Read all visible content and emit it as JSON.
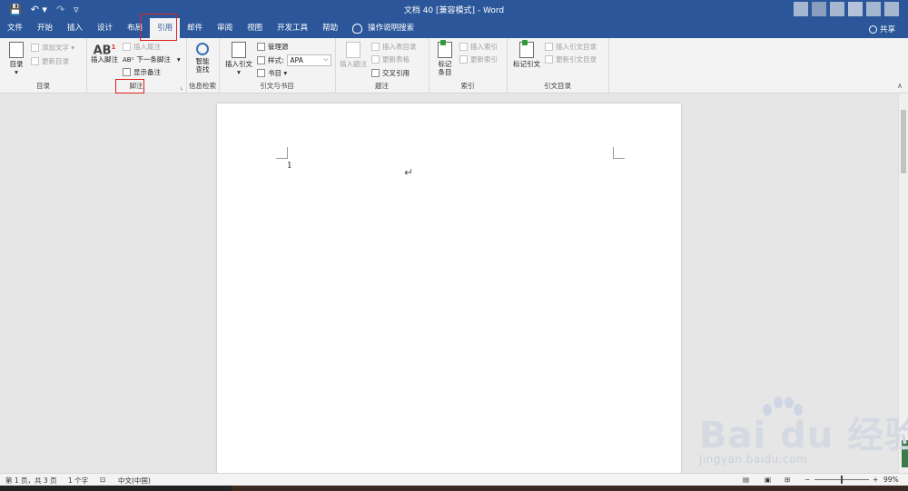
{
  "title_bar": {
    "doc_title": "文档 40 [兼容模式]  -  Word",
    "qat_icons": [
      "save-icon",
      "undo-icon",
      "redo-icon",
      "customize-icon"
    ]
  },
  "tabs": [
    "文件",
    "开始",
    "插入",
    "设计",
    "布局",
    "引用",
    "邮件",
    "审阅",
    "视图",
    "开发工具",
    "帮助"
  ],
  "active_tab": "引用",
  "tell_me": "操作说明搜索",
  "share": "共享",
  "ribbon": {
    "toc": {
      "label": "目录",
      "big": "目录",
      "add_text": "添加文字 ▾",
      "update": "更新目录"
    },
    "footnotes": {
      "label": "脚注",
      "insert_footnote": "插入脚注",
      "insert_endnote": "插入尾注",
      "next_footnote": "下一条脚注",
      "next_arrow": "▾",
      "show_notes": "显示备注"
    },
    "research": {
      "label": "信息检索",
      "smart_lookup_1": "智能",
      "smart_lookup_2": "查找"
    },
    "citations": {
      "label": "引文与书目",
      "insert_citation": "插入引文",
      "manage_sources": "管理源",
      "style": "样式:",
      "style_value": "APA",
      "bibliography": "书目 ▾"
    },
    "captions": {
      "label": "题注",
      "insert_caption": "插入题注",
      "insert_tof": "插入表目录",
      "update_table": "更新表格",
      "cross_ref": "交叉引用"
    },
    "index": {
      "label": "索引",
      "mark_entry_1": "标记",
      "mark_entry_2": "条目",
      "insert_index": "插入索引",
      "update_index": "更新索引"
    },
    "toa": {
      "label": "引文目录",
      "mark_citation": "标记引文",
      "insert_toa": "插入引文目录",
      "update_toa": "更新引文目录"
    }
  },
  "document": {
    "page_number": "1",
    "para_mark": "↵"
  },
  "watermark": {
    "brand": "Bai  du 经验",
    "url": "jingyan.baidu.com"
  },
  "status": {
    "page": "第 1 页，共 3 页",
    "words": "1 个字",
    "lang": "中文(中国)",
    "zoom": "99%",
    "zoom_minus": "−",
    "zoom_plus": "+"
  },
  "colors": {
    "accent": "#2b579a",
    "highlight": "#e02020"
  }
}
